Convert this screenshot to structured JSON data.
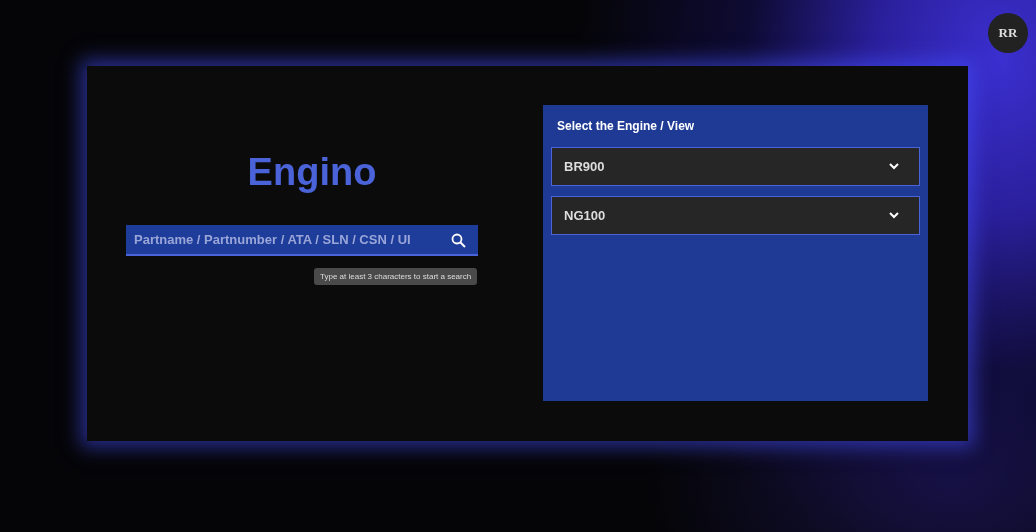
{
  "logo": "RR",
  "app": {
    "title": "Engino"
  },
  "search": {
    "placeholder": "Partname / Partnumber / ATA / SLN / CSN / UI",
    "hint": "Type at least 3 characters to start a search"
  },
  "engine_panel": {
    "heading": "Select the Engine / View",
    "engines": [
      {
        "label": "BR900",
        "expanded": false
      },
      {
        "label": "NG100",
        "expanded": false
      }
    ]
  }
}
